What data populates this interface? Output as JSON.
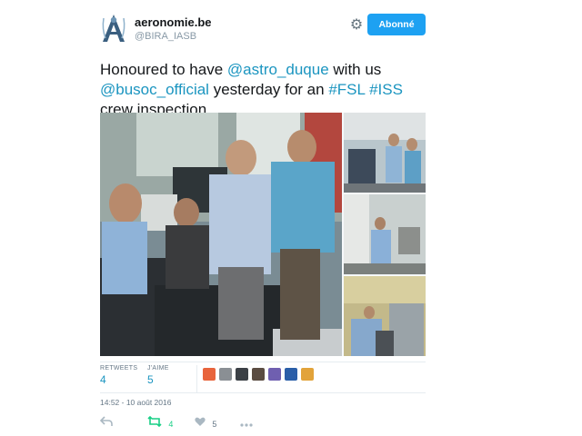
{
  "account": {
    "display_name": "aeronomie.be",
    "handle": "@BIRA_IASB",
    "avatar_icon": "bira-iasb-logo"
  },
  "follow_button": {
    "label": "Abonné",
    "color": "#1da1f2"
  },
  "tweet": {
    "segments": [
      {
        "text": "Honoured to have ",
        "link": false
      },
      {
        "text": "@astro_duque",
        "link": true
      },
      {
        "text": " with us ",
        "link": false
      },
      {
        "text": "@busoc_official",
        "link": true
      },
      {
        "text": " yesterday for an ",
        "link": false
      },
      {
        "text": "#FSL",
        "link": true
      },
      {
        "text": " ",
        "link": false
      },
      {
        "text": "#ISS",
        "link": true
      },
      {
        "text": " crew inspection",
        "link": false
      }
    ],
    "link_color": "#1b95c0"
  },
  "stats": {
    "retweets_label": "RETWEETS",
    "retweets_value": "4",
    "likes_label": "J'AIME",
    "likes_value": "5"
  },
  "timestamp": "14:52 - 10 août 2016",
  "actions": {
    "reply_icon": "reply-icon",
    "retweet_icon": "retweet-icon",
    "retweet_count": "4",
    "like_icon": "heart-icon",
    "like_count": "5",
    "more_icon": "more-icon"
  },
  "colors": {
    "retweet_active": "#19cf86",
    "secondary_text": "#657786"
  }
}
